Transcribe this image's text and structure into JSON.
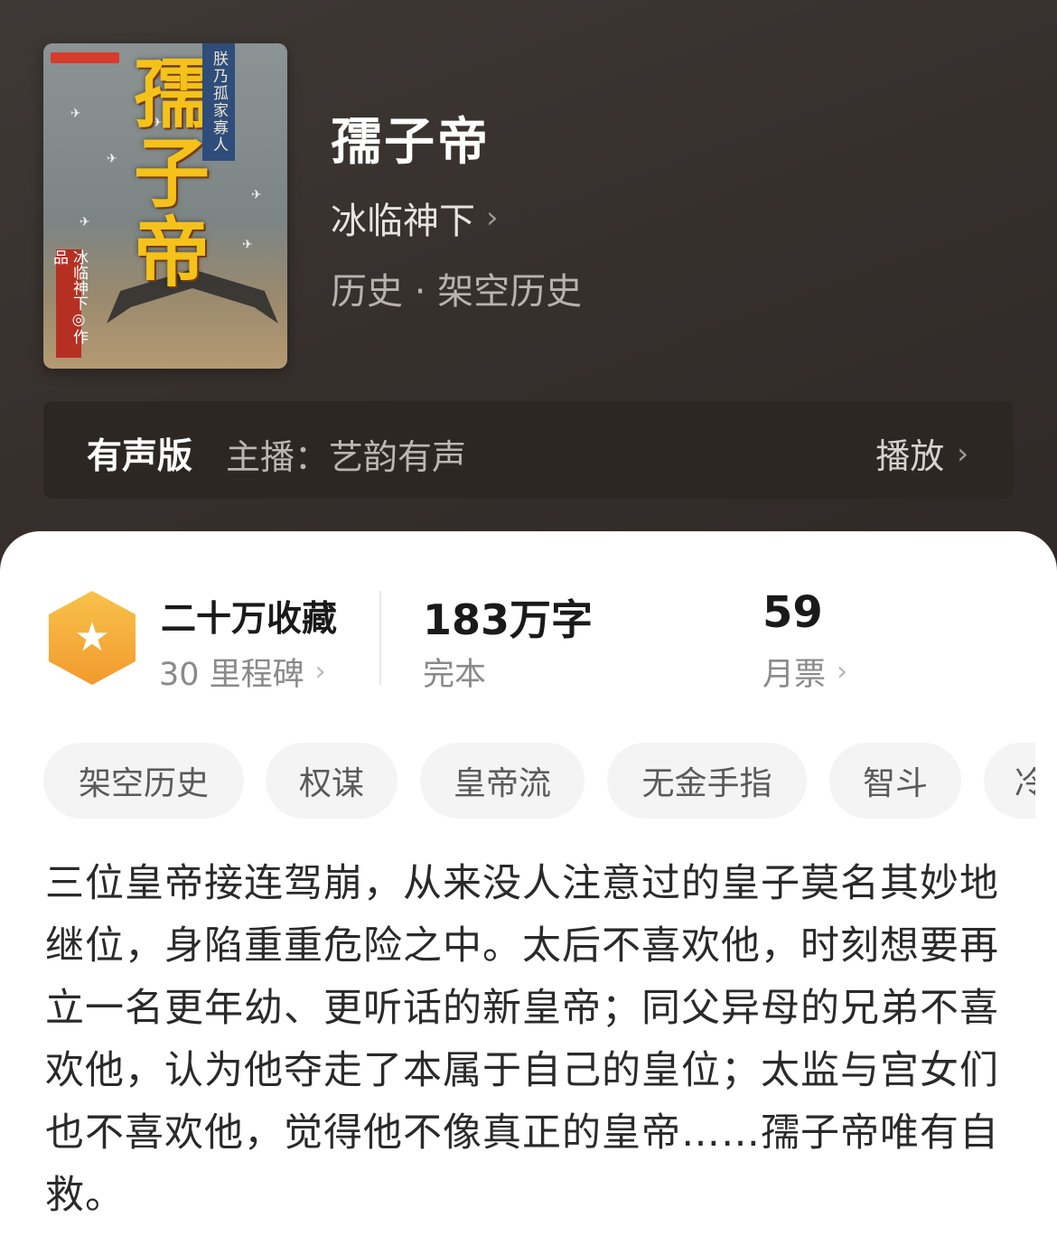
{
  "book": {
    "title": "孺子帝",
    "author": "冰临神下",
    "genre": "历史 · 架空历史",
    "cover": {
      "title": "孺子帝",
      "tagline": "朕乃孤家寡人",
      "author_line": "冰临神下◎作品"
    }
  },
  "audio": {
    "label": "有声版",
    "anchor": "主播：艺韵有声",
    "play_label": "播放"
  },
  "stats": {
    "collections": {
      "main": "二十万收藏",
      "sub": "30 里程碑"
    },
    "words": {
      "main": "183万字",
      "sub": "完本"
    },
    "tickets": {
      "main": "59",
      "sub": "月票"
    }
  },
  "tags": [
    "架空历史",
    "权谋",
    "皇帝流",
    "无金手指",
    "智斗",
    "冷"
  ],
  "synopsis": "三位皇帝接连驾崩，从来没人注意过的皇子莫名其妙地继位，身陷重重危险之中。太后不喜欢他，时刻想要再立一名更年幼、更听话的新皇帝；同父异母的兄弟不喜欢他，认为他夺走了本属于自己的皇位；太监与宫女们也不喜欢他，觉得他不像真正的皇帝……孺子帝唯有自救。",
  "icons": {
    "chevron": "›",
    "star": "★",
    "bird": "✈"
  },
  "colors": {
    "hero_bg": "#3a3330",
    "badge_gold": "#f4b23a",
    "tag_bg": "#f4f4f4"
  }
}
